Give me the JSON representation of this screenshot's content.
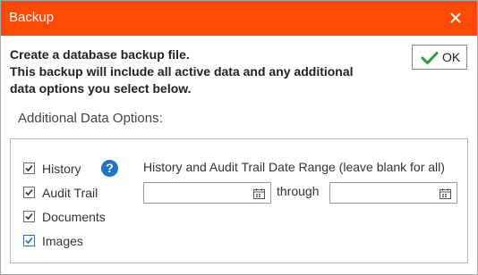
{
  "window": {
    "title": "Backup",
    "accent_color": "#ff4a07"
  },
  "intro": {
    "line1": "Create a database backup file.",
    "line2": "This backup will include all active data and any additional",
    "line3": "data options you select below."
  },
  "ok_button": {
    "label": "OK",
    "icon": "checkmark-icon",
    "icon_color": "#2e9b3a"
  },
  "options": {
    "section_label": "Additional Data Options:",
    "items": [
      {
        "label": "History",
        "checked": true
      },
      {
        "label": "Audit Trail",
        "checked": true
      },
      {
        "label": "Documents",
        "checked": true
      },
      {
        "label": "Images",
        "checked": true
      }
    ],
    "help_icon": "?"
  },
  "date_range": {
    "label": "History and Audit Trail Date Range (leave blank for all)",
    "from_value": "",
    "through_label": "through",
    "to_value": "",
    "calendar_icon": "calendar-icon"
  }
}
